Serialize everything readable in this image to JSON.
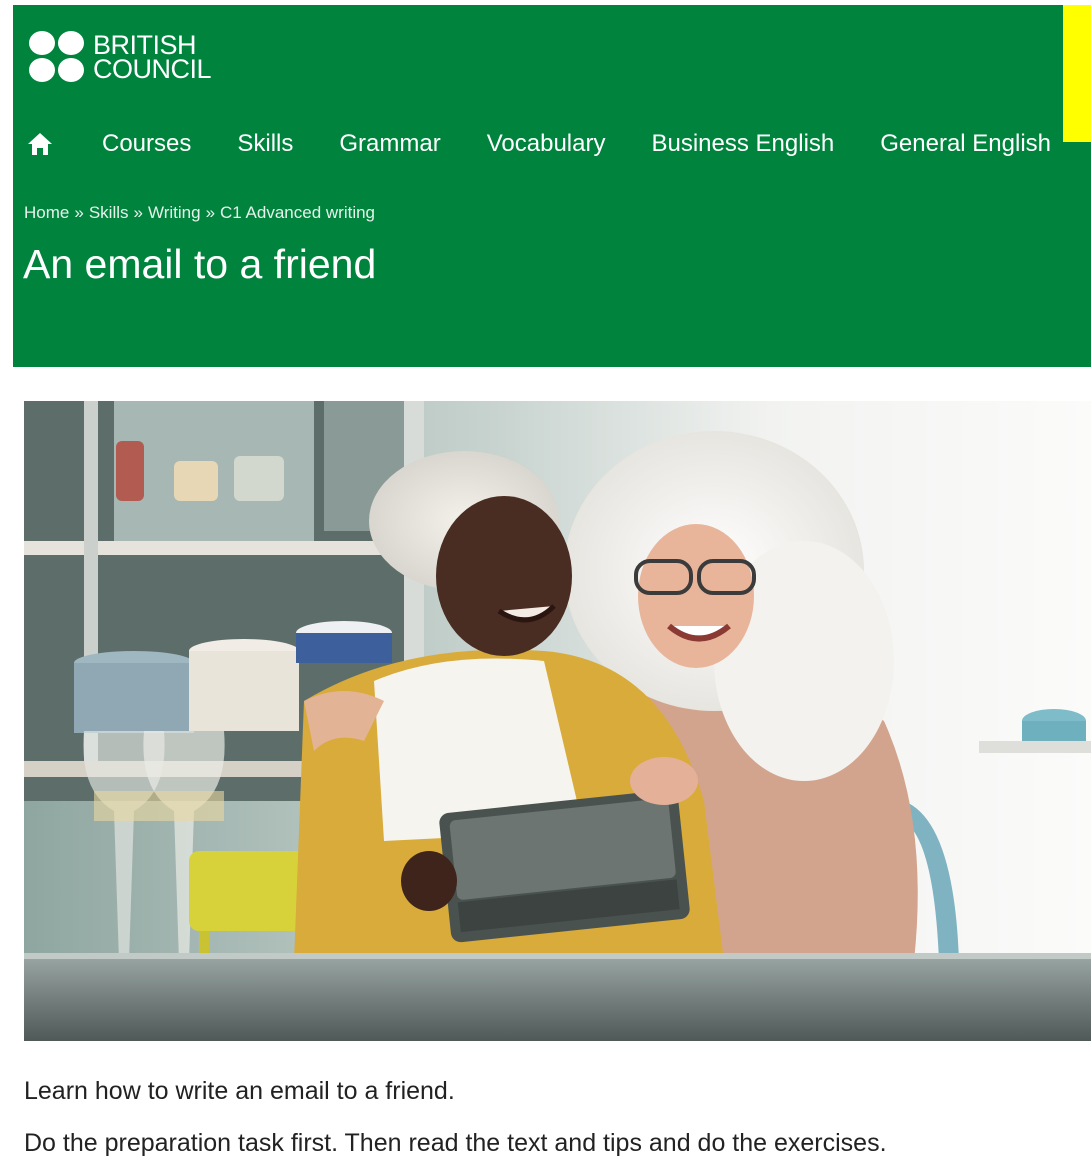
{
  "brand": {
    "line1": "BRITISH",
    "line2": "COUNCIL"
  },
  "colors": {
    "header_green": "#00843d",
    "highlight_yellow": "#ffff00",
    "text": "#222222"
  },
  "nav": {
    "home_icon": "home-icon",
    "items": [
      "Courses",
      "Skills",
      "Grammar",
      "Vocabulary",
      "Business English",
      "General English"
    ]
  },
  "breadcrumb": {
    "items": [
      "Home",
      "Skills",
      "Writing",
      "C1 Advanced writing"
    ],
    "separator": "»"
  },
  "page": {
    "title": "An email to a friend"
  },
  "hero": {
    "icon": "photo-two-women-with-tablet"
  },
  "body": {
    "intro": "Learn how to write an email to a friend.",
    "instructions": "Do the preparation task first. Then read the text and tips and do the exercises."
  }
}
